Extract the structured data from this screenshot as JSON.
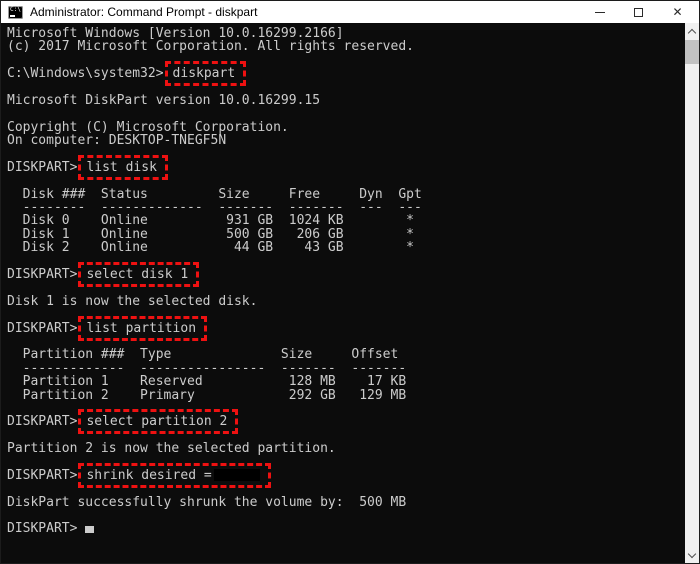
{
  "window": {
    "title": "Administrator: Command Prompt - diskpart",
    "icon": "cmd-icon",
    "icon_text": "C:\\",
    "controls": [
      {
        "name": "minimize",
        "label": "minimize-button"
      },
      {
        "name": "maximize",
        "label": "maximize-button"
      },
      {
        "name": "close",
        "label": "close-button"
      }
    ]
  },
  "colors": {
    "console_background": "#0c0c0c",
    "console_text": "#cccccc",
    "highlight_box": "#ee1111",
    "titlebar_background": "#ffffff",
    "redaction": "#000000"
  },
  "scrollbar": {
    "up_icon": "chevron-up-icon",
    "down_icon": "chevron-down-icon"
  },
  "terminal": {
    "lines": [
      {
        "type": "output",
        "text": "Microsoft Windows [Version 10.0.16299.2166]"
      },
      {
        "type": "output",
        "text": "(c) 2017 Microsoft Corporation. All rights reserved."
      },
      {
        "type": "blank"
      },
      {
        "type": "command",
        "prompt": "C:\\Windows\\system32>",
        "command": "diskpart"
      },
      {
        "type": "blank"
      },
      {
        "type": "output",
        "text": "Microsoft DiskPart version 10.0.16299.15"
      },
      {
        "type": "blank"
      },
      {
        "type": "output",
        "text": "Copyright (C) Microsoft Corporation."
      },
      {
        "type": "output",
        "text": "On computer: DESKTOP-TNEGF5N"
      },
      {
        "type": "blank"
      },
      {
        "type": "command",
        "prompt": "DISKPART>",
        "command": "list disk"
      },
      {
        "type": "blank"
      },
      {
        "type": "output",
        "text": "  Disk ###  Status         Size     Free     Dyn  Gpt"
      },
      {
        "type": "output",
        "text": "  --------  -------------  -------  -------  ---  ---"
      },
      {
        "type": "output",
        "text": "  Disk 0    Online          931 GB  1024 KB        *"
      },
      {
        "type": "output",
        "text": "  Disk 1    Online          500 GB   206 GB        *"
      },
      {
        "type": "output",
        "text": "  Disk 2    Online           44 GB    43 GB        *"
      },
      {
        "type": "blank"
      },
      {
        "type": "command",
        "prompt": "DISKPART>",
        "command": "select disk 1"
      },
      {
        "type": "blank"
      },
      {
        "type": "output",
        "text": "Disk 1 is now the selected disk."
      },
      {
        "type": "blank"
      },
      {
        "type": "command",
        "prompt": "DISKPART>",
        "command": "list partition"
      },
      {
        "type": "blank"
      },
      {
        "type": "output",
        "text": "  Partition ###  Type              Size     Offset"
      },
      {
        "type": "output",
        "text": "  -------------  ----------------  -------  -------"
      },
      {
        "type": "output",
        "text": "  Partition 1    Reserved           128 MB    17 KB"
      },
      {
        "type": "output",
        "text": "  Partition 2    Primary            292 GB   129 MB"
      },
      {
        "type": "blank"
      },
      {
        "type": "command",
        "prompt": "DISKPART>",
        "command": "select partition 2"
      },
      {
        "type": "blank"
      },
      {
        "type": "output",
        "text": "Partition 2 is now the selected partition."
      },
      {
        "type": "blank"
      },
      {
        "type": "command",
        "prompt": "DISKPART>",
        "command": "shrink desired =",
        "redacted": true
      },
      {
        "type": "blank"
      },
      {
        "type": "output",
        "text": "DiskPart successfully shrunk the volume by:  500 MB"
      },
      {
        "type": "blank"
      },
      {
        "type": "prompt",
        "prompt": "DISKPART> ",
        "cursor": true
      }
    ]
  }
}
